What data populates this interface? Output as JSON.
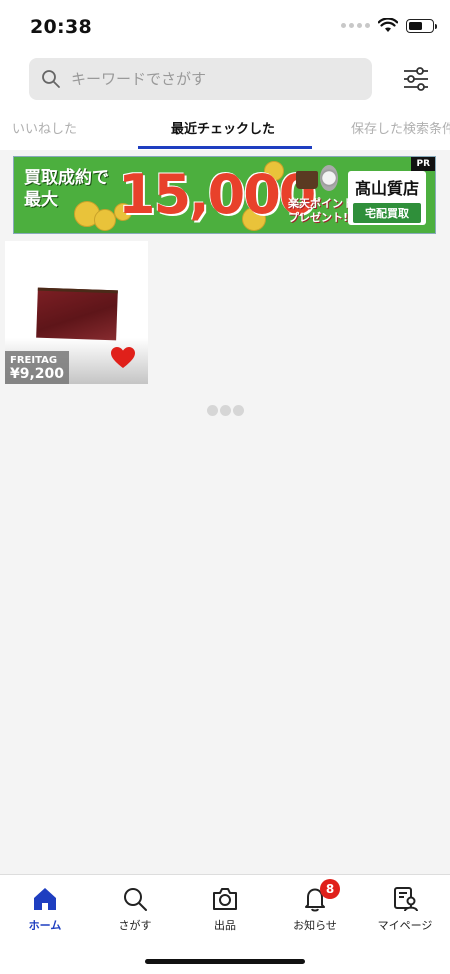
{
  "status_bar": {
    "time": "20:38"
  },
  "search": {
    "placeholder": "キーワードでさがす"
  },
  "tabs": [
    {
      "label": "いいねした"
    },
    {
      "label": "最近チェックした",
      "active": true
    },
    {
      "label": "保存した検索条件"
    }
  ],
  "banner": {
    "line1": "買取成約で",
    "line2": "最大",
    "amount": "15,000",
    "points_line1": "楽天ポイント",
    "points_line2": "プレゼント!",
    "brand": "髙山質店",
    "brand_sub": "宅配買取",
    "pr": "PR"
  },
  "products": [
    {
      "brand": "FREITAG",
      "price": "¥9,200",
      "liked": true
    }
  ],
  "nav": {
    "items": [
      {
        "label": "ホーム",
        "icon": "home-icon",
        "active": true
      },
      {
        "label": "さがす",
        "icon": "search-icon"
      },
      {
        "label": "出品",
        "icon": "camera-icon"
      },
      {
        "label": "お知らせ",
        "icon": "bell-icon",
        "badge": "8"
      },
      {
        "label": "マイページ",
        "icon": "mypage-icon"
      }
    ]
  },
  "colors": {
    "accent": "#1e3ec0",
    "badge": "#e0201a",
    "like": "#e0201a",
    "banner_bg": "#4caf3e"
  }
}
